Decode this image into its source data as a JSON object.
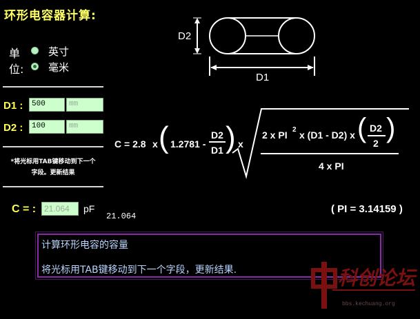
{
  "title": "环形电容器计算:",
  "units": {
    "label_line1": "单",
    "label_line2": "位:",
    "options": [
      {
        "label": "英寸",
        "selected": false
      },
      {
        "label": "毫米",
        "selected": true
      }
    ]
  },
  "diagram": {
    "d2_label": "D2",
    "d1_label": "D1"
  },
  "inputs": {
    "d1": {
      "label": "D1 :",
      "value": "500",
      "unit": "mm"
    },
    "d2": {
      "label": "D2 :",
      "value": "100",
      "unit": "mm"
    }
  },
  "note": {
    "line1": "*将光标用TAB键移动到下一个",
    "line2": "字段。更新结果"
  },
  "formula": {
    "c_eq": "C = 2.8",
    "x": "x",
    "const": "1.2781 -",
    "d2": "D2",
    "d1": "D1",
    "num_a": "2 x PI",
    "num_exp": "2",
    "num_b": "x (D1 - D2) x",
    "two": "2",
    "den": "4 x PI"
  },
  "result": {
    "label": "C = :",
    "value": "21.064",
    "unit": "pF",
    "echo": "21.064"
  },
  "pi_text": "( PI = 3.14159 )",
  "info": {
    "line1": "计算环形电容的容量",
    "line2": "将光标用TAB键移动到下一个字段，更新结果."
  },
  "watermark": {
    "text": "科创论坛",
    "sub": "bbs.kechuang.org"
  }
}
